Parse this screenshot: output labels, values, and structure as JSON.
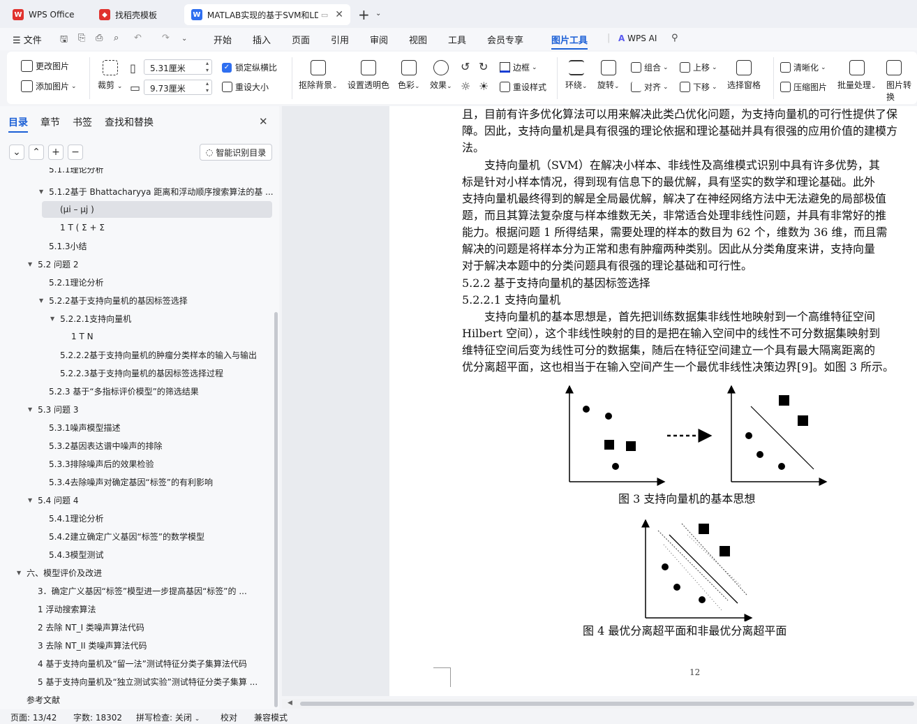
{
  "tabs": {
    "wps": "WPS Office",
    "template": "找稻壳模板",
    "doc": "MATLAB实现的基于SVM和LD"
  },
  "menu": {
    "file": "文件",
    "start": "开始",
    "insert": "插入",
    "page": "页面",
    "ref": "引用",
    "review": "审阅",
    "view": "视图",
    "tools": "工具",
    "member": "会员专享",
    "picture_tools": "图片工具",
    "wps_ai": "WPS AI"
  },
  "ribbon": {
    "change_pic": "更改图片",
    "add_pic": "添加图片",
    "crop": "裁剪",
    "width": "5.31厘米",
    "height": "9.73厘米",
    "lock_ratio": "锁定纵横比",
    "reset_size": "重设大小",
    "remove_bg": "抠除背景",
    "set_transparent": "设置透明色",
    "color": "色彩",
    "effect": "效果",
    "border": "边框",
    "reset_style": "重设样式",
    "wrap": "环绕",
    "rotate": "旋转",
    "group": "组合",
    "align": "对齐",
    "up": "上移",
    "down": "下移",
    "select_pane": "选择窗格",
    "sharpen": "清晰化",
    "compress": "压缩图片",
    "batch": "批量处理",
    "convert": "图片转换"
  },
  "sidebar": {
    "tabs": [
      "目录",
      "章节",
      "书签",
      "查找和替换"
    ],
    "smart": "智能识别目录",
    "items": [
      "5.1.1理论分析",
      "5.1.2基于 Bhattacharyya 距离和浮动顺序搜索算法的基 ...",
      "(μi – μj )",
      "1 T ( Σ + Σ",
      "5.1.3小结",
      "5.2 问题 2",
      "5.2.1理论分析",
      "5.2.2基于支持向量机的基因标签选择",
      "5.2.2.1支持向量机",
      "1  T  N",
      "5.2.2.2基于支持向量机的肿瘤分类样本的输入与输出",
      "5.2.2.3基于支持向量机的基因标签选择过程",
      "5.2.3 基于“多指标评价模型”的筛选结果",
      "5.3 问题 3",
      "5.3.1噪声模型描述",
      "5.3.2基因表达谱中噪声的排除",
      "5.3.3排除噪声后的效果检验",
      "5.3.4去除噪声对确定基因“标签”的有利影响",
      "5.4 问题 4",
      "5.4.1理论分析",
      "5.4.2建立确定广义基因“标签”的数学模型",
      "5.4.3模型测试",
      "六、模型评价及改进",
      "3．确定广义基因“标签”模型进一步提高基因“标签”的 ...",
      "1  浮动搜索算法",
      "2  去除 NT_I 类噪声算法代码",
      "3  去除 NT_II 类噪声算法代码",
      "4 基于支持向量机及“留一法”测试特征分类子集算法代码",
      "5 基于支持向量机及“独立测试实验”测试特征分类子集算 ...",
      "参考文献"
    ]
  },
  "doc": {
    "lines": [
      "且，目前有许多优化算法可以用来解决此类凸优化问题，为支持向量机的可行性提供了保",
      "障。因此，支持向量机是具有很强的理论依据和理论基础并具有很强的应用价值的建模方",
      "法。",
      "支持向量机（SVM）在解决小样本、非线性及高维模式识别中具有许多优势，其",
      "标是针对小样本情况，得到现有信息下的最优解，具有坚实的数学和理论基础。此外",
      "支持向量机最终得到的解是全局最优解，解决了在神经网络方法中无法避免的局部极值",
      "题，而且其算法复杂度与样本维数无关，非常适合处理非线性问题，并具有非常好的推",
      "能力。根据问题 1 所得结果，需要处理的样本的数目为 62 个，维数为 36 维，而且需",
      "解决的问题是将样本分为正常和患有肿瘤两种类别。因此从分类角度来讲，支持向量",
      "对于解决本题中的分类问题具有很强的理论基础和可行性。",
      "5.2.2  基于支持向量机的基因标签选择",
      "5.2.2.1 支持向量机",
      "支持向量机的基本思想是，首先把训练数据集非线性地映射到一个高维特征空间",
      "Hilbert 空间），这个非线性映射的目的是把在输入空间中的线性不可分数据集映射到",
      "维特征空间后变为线性可分的数据集，随后在特征空间建立一个具有最大隔离距离的",
      "优分离超平面，这也相当于在输入空间产生一个最优非线性决策边界[9]。如图 3 所示。"
    ],
    "fig3_caption": "图  3  支持向量机的基本思想",
    "fig4_caption": "图  4 最优分离超平面和非最优分离超平面",
    "page_number": "12"
  },
  "status": {
    "page": "页面: 13/42",
    "words": "字数: 18302",
    "spell": "拼写检查: 关闭",
    "proof": "校对",
    "compat": "兼容模式"
  }
}
